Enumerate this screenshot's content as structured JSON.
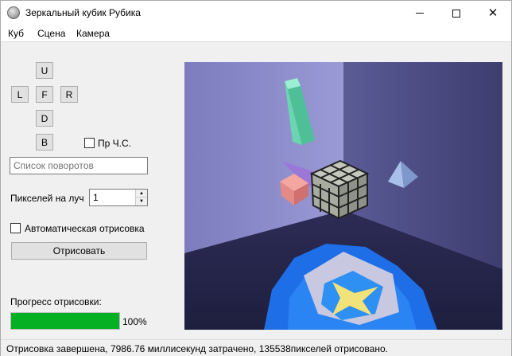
{
  "window": {
    "title": "Зеркальный кубик Рубика",
    "icon": "rubik-sphere-icon",
    "controls": {
      "minimize": "minimize-icon",
      "maximize": "maximize-icon",
      "close": "✕"
    }
  },
  "menu": {
    "items": [
      "Куб",
      "Сцена",
      "Камера"
    ]
  },
  "rotation_buttons": {
    "u": "U",
    "l": "L",
    "f": "F",
    "r": "R",
    "d": "D",
    "b": "B"
  },
  "ccw_checkbox": {
    "label": "Пр Ч.С.",
    "checked": false
  },
  "rotations_input": {
    "placeholder": "Список поворотов",
    "value": ""
  },
  "rays": {
    "label": "Пикселей на луч",
    "value": "1"
  },
  "auto_render": {
    "label": "Автоматическая отрисовка",
    "checked": false
  },
  "render_button": {
    "label": "Отрисовать"
  },
  "progress": {
    "label": "Прогресс отрисовки:",
    "value": 100,
    "text": "100%",
    "color": "#06b025"
  },
  "status": {
    "text": "Отрисовка завершена, 7986.76 миллисекунд затрачено, 135538пикселей отрисовано."
  },
  "colors": {
    "accent": "#06b025",
    "title_bg": "#ffffff",
    "viewport_bg": "#3a3a66"
  }
}
